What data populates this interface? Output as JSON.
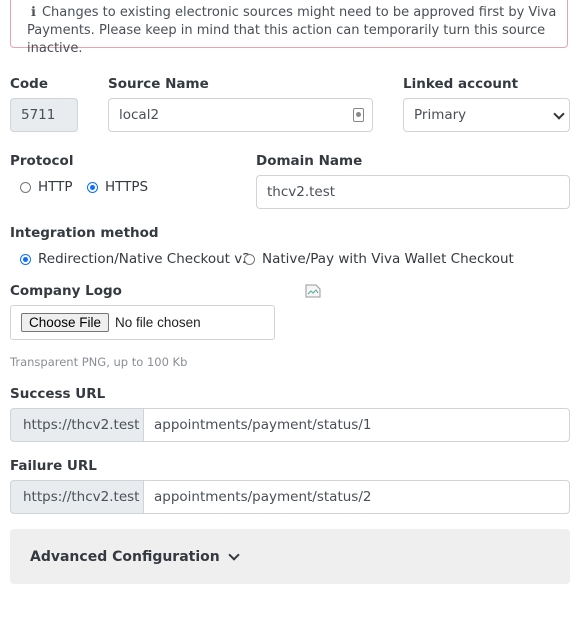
{
  "alert": {
    "icon": "info-icon",
    "text": "Changes to existing electronic sources might need to be approved first by Viva Payments. Please keep in mind that this action can temporarily turn this source inactive."
  },
  "code": {
    "label": "Code",
    "value": "5711"
  },
  "source_name": {
    "label": "Source Name",
    "value": "local2"
  },
  "linked_account": {
    "label": "Linked account",
    "value": "Primary"
  },
  "protocol": {
    "label": "Protocol",
    "options": [
      "HTTP",
      "HTTPS"
    ],
    "selected": "HTTPS"
  },
  "domain_name": {
    "label": "Domain Name",
    "value": "thcv2.test"
  },
  "integration_method": {
    "label": "Integration method",
    "options": [
      "Redirection/Native Checkout v2",
      "Native/Pay with Viva Wallet Checkout"
    ],
    "selected": "Redirection/Native Checkout v2"
  },
  "company_logo": {
    "label": "Company Logo",
    "button": "Choose File",
    "status": "No file chosen",
    "hint": "Transparent PNG, up to 100 Kb"
  },
  "success_url": {
    "label": "Success URL",
    "prefix": "https://thcv2.test",
    "value": "appointments/payment/status/1"
  },
  "failure_url": {
    "label": "Failure URL",
    "prefix": "https://thcv2.test",
    "value": "appointments/payment/status/2"
  },
  "advanced": {
    "label": "Advanced Configuration"
  }
}
